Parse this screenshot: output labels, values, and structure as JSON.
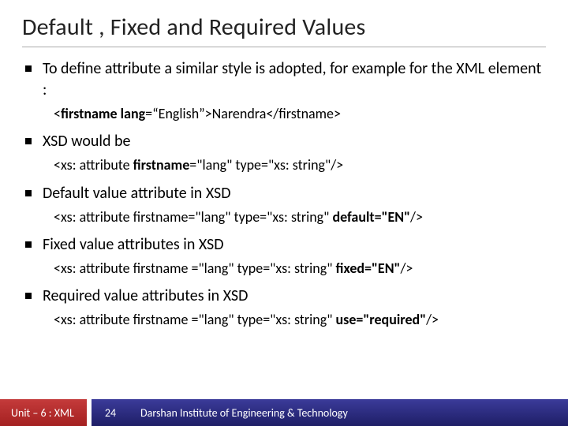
{
  "title": "Default , Fixed and Required Values",
  "bullets": [
    {
      "text": "To define attribute a similar style is adopted, for example for the XML element :",
      "code_parts": [
        {
          "t": "<",
          "b": false
        },
        {
          "t": "firstname lang",
          "b": true
        },
        {
          "t": "=“English”>Narendra</firstname>",
          "b": false
        }
      ]
    },
    {
      "text": "XSD would be",
      "code_parts": [
        {
          "t": "<xs: attribute ",
          "b": false
        },
        {
          "t": "firstname",
          "b": true
        },
        {
          "t": "=\"lang\" type=\"xs: string\"/>",
          "b": false
        }
      ]
    },
    {
      "text": "Default value attribute in XSD",
      "code_parts": [
        {
          "t": "<xs: attribute firstname=\"lang\" type=\"xs: string\" ",
          "b": false
        },
        {
          "t": "default=\"EN\"",
          "b": true
        },
        {
          "t": "/>",
          "b": false
        }
      ]
    },
    {
      "text": "Fixed value attributes in XSD",
      "code_parts": [
        {
          "t": "<xs: attribute firstname =\"lang\" type=\"xs: string\" ",
          "b": false
        },
        {
          "t": "fixed=\"EN\"",
          "b": true
        },
        {
          "t": "/>",
          "b": false
        }
      ]
    },
    {
      "text": "Required value attributes in XSD",
      "code_parts": [
        {
          "t": "<xs: attribute firstname =\"lang\" type=\"xs: string\" ",
          "b": false
        },
        {
          "t": "use=\"required\"",
          "b": true
        },
        {
          "t": "/>",
          "b": false
        }
      ]
    }
  ],
  "footer": {
    "unit": "Unit – 6 : XML",
    "page": "24",
    "org": "Darshan Institute of Engineering & Technology"
  }
}
